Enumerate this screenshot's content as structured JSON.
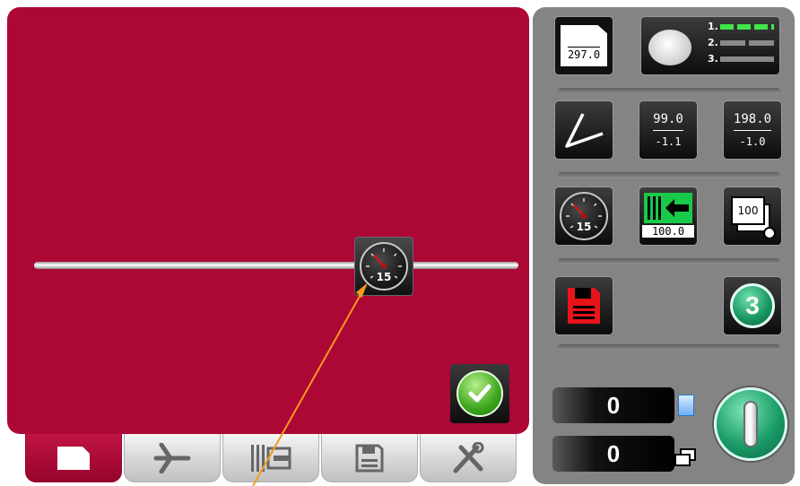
{
  "slider": {
    "speed_value": "15"
  },
  "right_panel": {
    "sheet_length": "297.0",
    "roller_stages": [
      "1.",
      "2.",
      "3."
    ],
    "fold_position_1": {
      "top": "99.0",
      "bottom": "-1.1"
    },
    "fold_position_2": {
      "top": "198.0",
      "bottom": "-1.0"
    },
    "speed_value": "15",
    "feed_value": "100.0",
    "stack_value": "100",
    "program_number": "3",
    "counter_sheets": "0",
    "counter_stacks": "0"
  },
  "tabs": [
    "sheet-tab",
    "fold-tab",
    "feed-tab",
    "save-tab",
    "tools-tab"
  ],
  "colors": {
    "accent": "#ad0736",
    "panel": "#848484",
    "go": "#1a9c68"
  },
  "icons": [
    "speedometer-icon",
    "checkmark-icon",
    "floppy-disk-icon",
    "fold-icon",
    "document-icon",
    "stack-icon",
    "wrench-screwdriver-icon"
  ]
}
